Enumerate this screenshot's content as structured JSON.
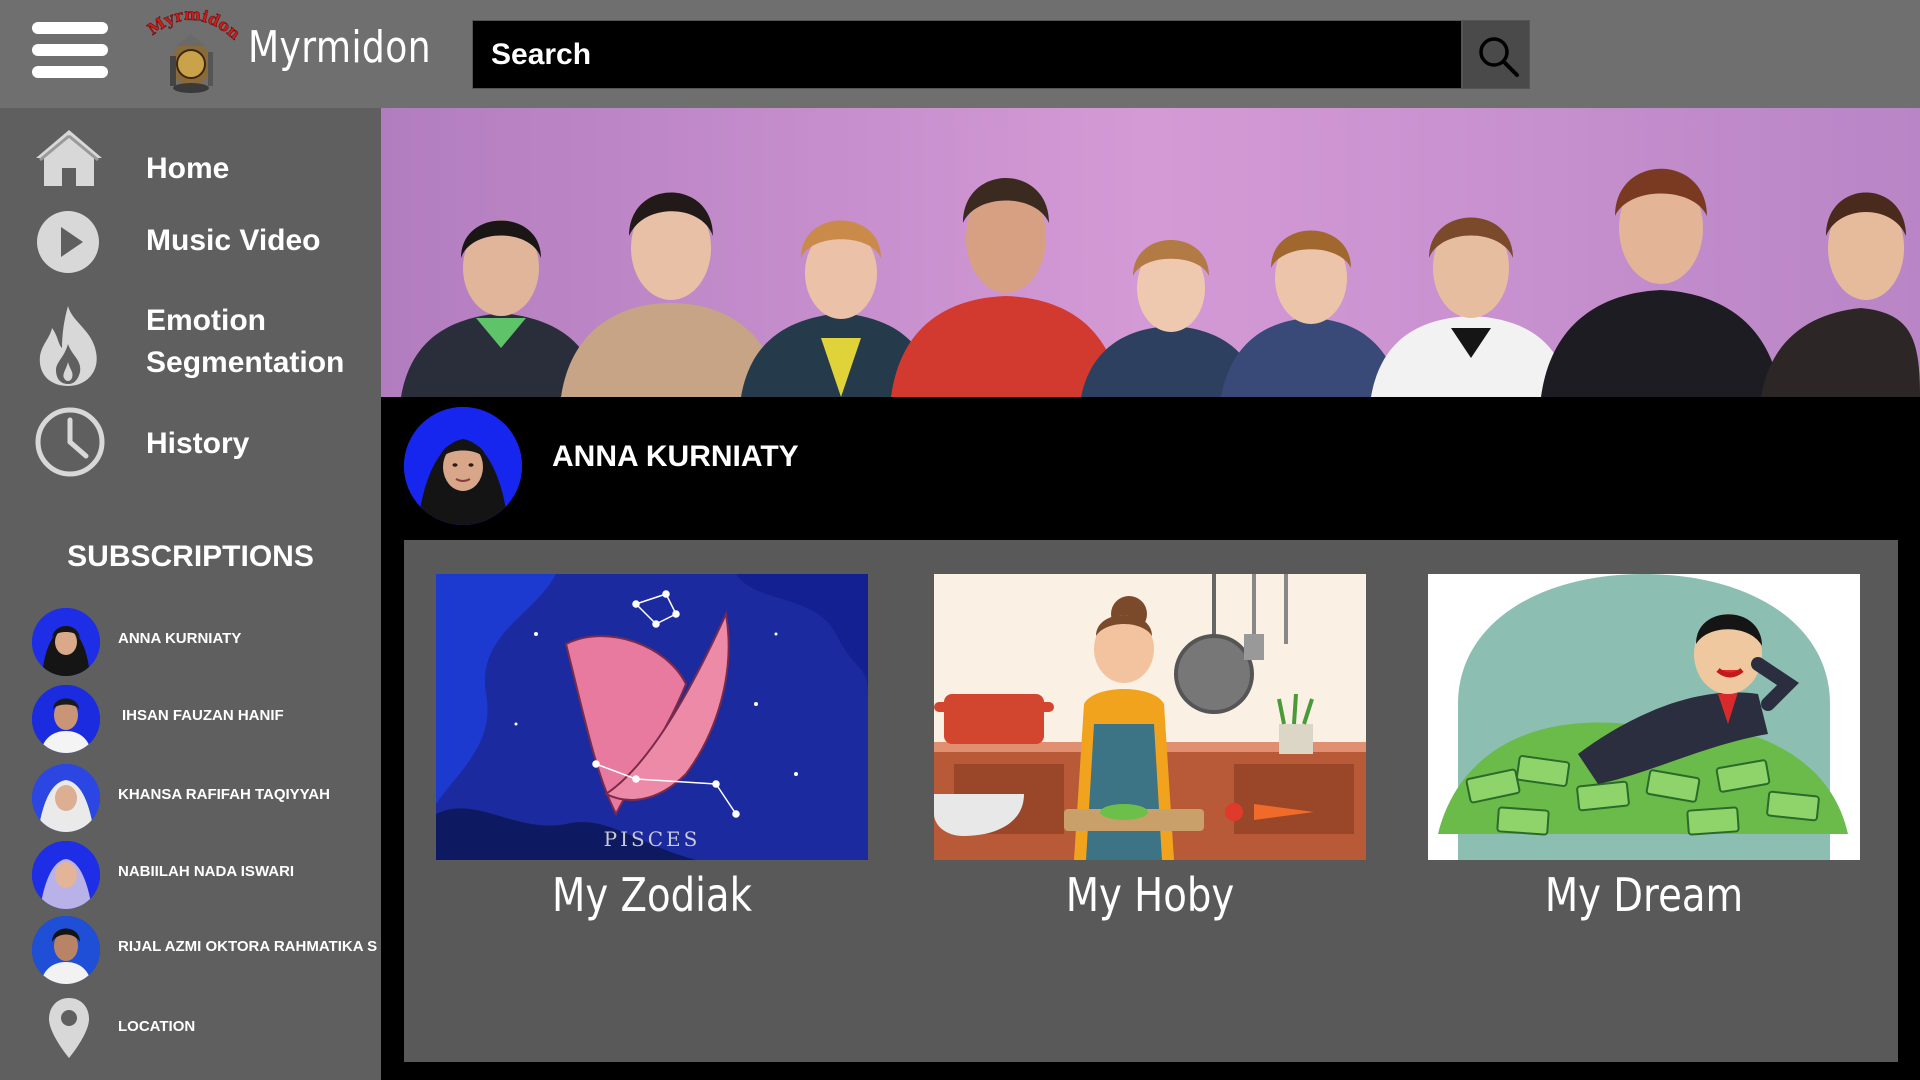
{
  "app": {
    "title": "Myrmidon",
    "logo_text": "Myrmidon"
  },
  "search": {
    "placeholder": "Search"
  },
  "nav": [
    {
      "label": "Home",
      "icon": "home-icon"
    },
    {
      "label": "Music Video",
      "icon": "play-icon"
    },
    {
      "label": "Emotion Segmentation",
      "icon": "flame-icon"
    },
    {
      "label": "History",
      "icon": "clock-icon"
    }
  ],
  "subscriptions": {
    "title": "SUBSCRIPTIONS",
    "items": [
      {
        "name": "ANNA KURNIATY"
      },
      {
        "name": "IHSAN FAUZAN HANIF"
      },
      {
        "name": "KHANSA RAFIFAH TAQIYYAH"
      },
      {
        "name": "NABIILAH NADA ISWARI"
      },
      {
        "name": "RIJAL AZMI OKTORA RAHMATIKA S"
      }
    ],
    "location_label": "LOCATION"
  },
  "channel": {
    "name": "ANNA KURNIATY"
  },
  "cards": [
    {
      "title": "My Zodiak",
      "thumb_text": "PISCES"
    },
    {
      "title": "My Hoby"
    },
    {
      "title": "My Dream"
    }
  ],
  "colors": {
    "topbar": "#6f6f6f",
    "sidebar": "#5f5f5f",
    "panel": "#595959",
    "background": "#000000",
    "banner": "#c48fd0"
  }
}
